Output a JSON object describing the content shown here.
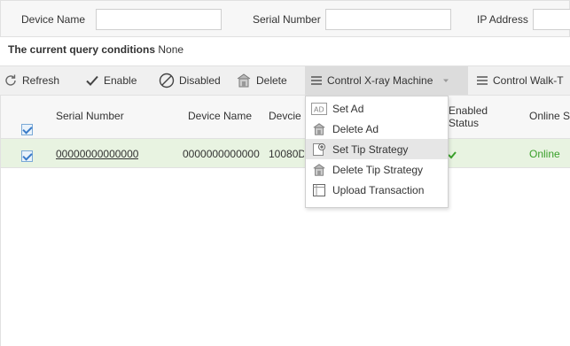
{
  "search": {
    "device_name_label": "Device Name",
    "device_name_value": "",
    "serial_number_label": "Serial Number",
    "serial_number_value": "",
    "ip_address_label": "IP Address",
    "ip_address_value": ""
  },
  "query": {
    "label": "The current query conditions",
    "value": "None"
  },
  "toolbar": {
    "refresh": "Refresh",
    "enable": "Enable",
    "disabled": "Disabled",
    "delete": "Delete",
    "control_xray": "Control X-ray Machine",
    "control_walk": "Control Walk-T"
  },
  "table": {
    "headers": {
      "serial_number": "Serial Number",
      "device_name": "Device Name",
      "device_type": "Devcie",
      "enabled_status": "Enabled Status",
      "online_status": "Online S"
    },
    "rows": [
      {
        "checked": true,
        "serial_number": "00000000000000",
        "device_name": "0000000000000",
        "device_type": "10080D",
        "online_status": "Online"
      }
    ]
  },
  "dropdown_menu": {
    "items": [
      {
        "label": "Set Ad",
        "icon": "ad-icon"
      },
      {
        "label": "Delete Ad",
        "icon": "delete-icon"
      },
      {
        "label": "Set Tip Strategy",
        "icon": "add-document-icon"
      },
      {
        "label": "Delete Tip Strategy",
        "icon": "delete-icon"
      },
      {
        "label": "Upload Transaction",
        "icon": "upload-icon"
      }
    ],
    "highlighted_index": 2
  },
  "colors": {
    "online": "#3aa02b",
    "selected_row": "#e8f3e1",
    "checkbox_border": "#7aa9d6",
    "check_mark": "#3a7bc8"
  }
}
